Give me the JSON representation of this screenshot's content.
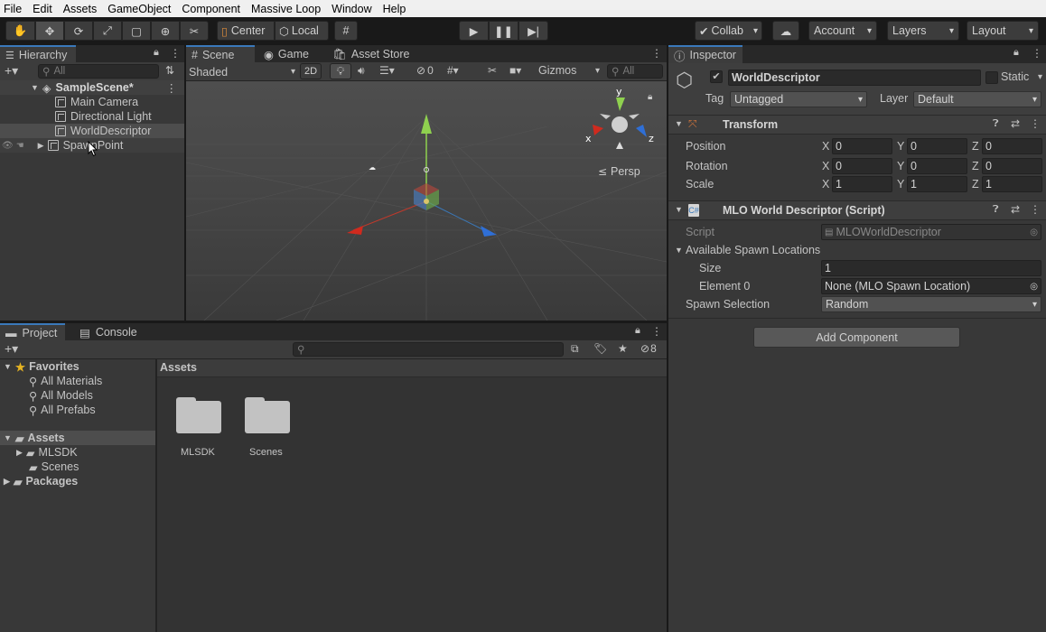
{
  "menu": [
    "File",
    "Edit",
    "Assets",
    "GameObject",
    "Component",
    "Massive Loop",
    "Window",
    "Help"
  ],
  "toolbar": {
    "pivot": "Center",
    "space": "Local",
    "collab": "Collab",
    "account": "Account",
    "layers": "Layers",
    "layout": "Layout"
  },
  "hierarchy": {
    "tab": "Hierarchy",
    "search_placeholder": "All",
    "scene": "SampleScene*",
    "items": [
      "Main Camera",
      "Directional Light",
      "WorldDescriptor",
      "SpawnPoint"
    ]
  },
  "scene_view": {
    "tabs": [
      "Scene",
      "Game",
      "Asset Store"
    ],
    "shading": "Shaded",
    "mode_2d": "2D",
    "hidden_count": "0",
    "gizmos": "Gizmos",
    "search_placeholder": "All",
    "persp": "Persp",
    "axis_x": "x",
    "axis_y": "y",
    "axis_z": "z"
  },
  "inspector": {
    "tab": "Inspector",
    "object_name": "WorldDescriptor",
    "static_label": "Static",
    "tag_label": "Tag",
    "tag_value": "Untagged",
    "layer_label": "Layer",
    "layer_value": "Default",
    "transform": {
      "title": "Transform",
      "position_label": "Position",
      "rotation_label": "Rotation",
      "scale_label": "Scale",
      "axis_x": "X",
      "axis_y": "Y",
      "axis_z": "Z",
      "position": [
        "0",
        "0",
        "0"
      ],
      "rotation": [
        "0",
        "0",
        "0"
      ],
      "scale": [
        "1",
        "1",
        "1"
      ]
    },
    "script_component": {
      "title": "MLO World Descriptor (Script)",
      "script_label": "Script",
      "script_value": "MLOWorldDescriptor",
      "spawn_locations_label": "Available Spawn Locations",
      "size_label": "Size",
      "size_value": "1",
      "element0_label": "Element 0",
      "element0_value": "None (MLO Spawn Location)",
      "spawn_selection_label": "Spawn Selection",
      "spawn_selection_value": "Random"
    },
    "add_component": "Add Component"
  },
  "project": {
    "tabs": [
      "Project",
      "Console"
    ],
    "hidden_count": "8",
    "favorites_label": "Favorites",
    "favorites": [
      "All Materials",
      "All Models",
      "All Prefabs"
    ],
    "assets_label": "Assets",
    "asset_folders": [
      "MLSDK",
      "Scenes"
    ],
    "packages_label": "Packages",
    "breadcrumb": "Assets",
    "grid_items": [
      "MLSDK",
      "Scenes"
    ]
  },
  "colors": {
    "accent": "#3a79bb",
    "panel": "#383838",
    "selected_row": "#4d4d4d"
  }
}
